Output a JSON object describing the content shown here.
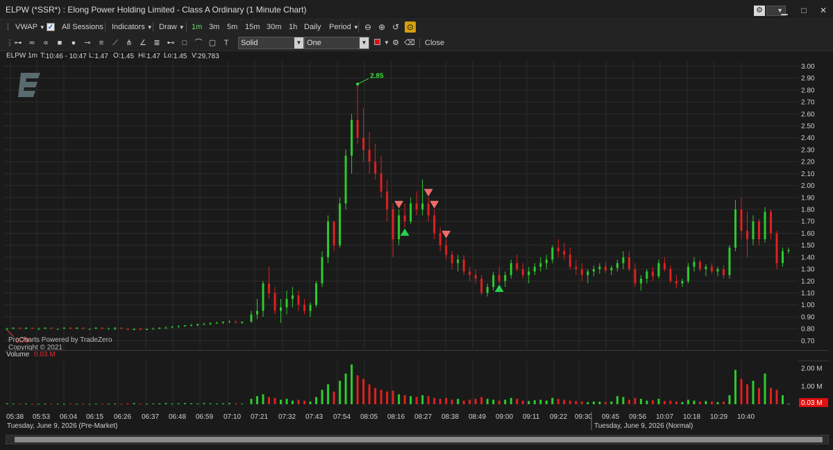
{
  "window": {
    "title": "ELPW (*SSR*) : Elong Power Holding Limited - Class A Ordinary (1 Minute Chart)",
    "minimize": "▁",
    "maximize": "□",
    "close": "✕"
  },
  "toolbar1": {
    "vwap": "VWAP",
    "all_sessions": "All Sessions",
    "indicators": "Indicators",
    "draw": "Draw",
    "intervals": [
      "1m",
      "3m",
      "5m",
      "15m",
      "30m",
      "1h",
      "Daily"
    ],
    "active_interval": "1m",
    "period": "Period"
  },
  "toolbar2": {
    "line_style": "Solid",
    "line_width": "One",
    "close_label": "Close"
  },
  "infobar": {
    "symbol": "ELPW 1m",
    "time": "10:46 - 10:47",
    "last": "1.47",
    "open": "1.45",
    "high": "1.47",
    "low": "1.45",
    "volume": "29,783"
  },
  "volume_panel": {
    "label": "Volume",
    "value": "0.03 M",
    "axis_ticks": [
      "2.00 M",
      "1.00 M"
    ],
    "current_badge": "0.03 M"
  },
  "watermark": {
    "line1": "ProCharts Powered by TradeZero",
    "line2": "Copyright © 2021"
  },
  "x_axis": {
    "ticks": [
      "05:38",
      "05:53",
      "06:04",
      "06:15",
      "06:26",
      "06:37",
      "06:48",
      "06:59",
      "07:10",
      "07:21",
      "07:32",
      "07:43",
      "07:54",
      "08:05",
      "08:16",
      "08:27",
      "08:38",
      "08:49",
      "09:00",
      "09:11",
      "09:22",
      "09:30",
      "09:45",
      "09:56",
      "10:07",
      "10:18",
      "10:29",
      "10:40"
    ],
    "session_premarket": "Tuesday, June 9, 2026 (Pre-Market)",
    "session_normal": "Tuesday, June 9, 2026 (Normal)"
  },
  "chart_data": {
    "type": "candlestick",
    "y_ticks": [
      "3.00",
      "2.90",
      "2.80",
      "2.70",
      "2.60",
      "2.50",
      "2.40",
      "2.30",
      "2.20",
      "2.10",
      "2.00",
      "1.90",
      "1.80",
      "1.70",
      "1.60",
      "1.50",
      "1.40",
      "1.30",
      "1.20",
      "1.10",
      "1.00",
      "0.90",
      "0.80",
      "0.70"
    ],
    "ylim": [
      0.65,
      3.02
    ],
    "high_label": "2.85",
    "low_label": "0.79",
    "colors": {
      "up": "#2ecc2e",
      "down": "#e02020",
      "background": "#1a1a1a",
      "grid": "#2c2c2c"
    },
    "bars": [
      [
        0.8,
        0.81,
        0.79,
        0.8
      ],
      [
        0.8,
        0.81,
        0.8,
        0.81
      ],
      [
        0.81,
        0.81,
        0.8,
        0.8
      ],
      [
        0.8,
        0.81,
        0.8,
        0.81
      ],
      [
        0.81,
        0.81,
        0.8,
        0.8
      ],
      [
        0.8,
        0.81,
        0.79,
        0.8
      ],
      [
        0.8,
        0.81,
        0.8,
        0.81
      ],
      [
        0.81,
        0.81,
        0.8,
        0.8
      ],
      [
        0.8,
        0.8,
        0.79,
        0.8
      ],
      [
        0.8,
        0.81,
        0.8,
        0.81
      ],
      [
        0.81,
        0.81,
        0.8,
        0.8
      ],
      [
        0.8,
        0.81,
        0.8,
        0.81
      ],
      [
        0.81,
        0.81,
        0.8,
        0.8
      ],
      [
        0.8,
        0.8,
        0.79,
        0.8
      ],
      [
        0.8,
        0.81,
        0.8,
        0.81
      ],
      [
        0.81,
        0.81,
        0.8,
        0.8
      ],
      [
        0.8,
        0.81,
        0.8,
        0.8
      ],
      [
        0.8,
        0.81,
        0.79,
        0.81
      ],
      [
        0.81,
        0.81,
        0.8,
        0.8
      ],
      [
        0.8,
        0.8,
        0.79,
        0.79
      ],
      [
        0.79,
        0.8,
        0.79,
        0.8
      ],
      [
        0.8,
        0.81,
        0.79,
        0.79
      ],
      [
        0.79,
        0.8,
        0.79,
        0.8
      ],
      [
        0.8,
        0.81,
        0.8,
        0.8
      ],
      [
        0.8,
        0.81,
        0.8,
        0.81
      ],
      [
        0.81,
        0.82,
        0.8,
        0.81
      ],
      [
        0.81,
        0.82,
        0.81,
        0.82
      ],
      [
        0.82,
        0.83,
        0.81,
        0.82
      ],
      [
        0.82,
        0.83,
        0.82,
        0.83
      ],
      [
        0.83,
        0.84,
        0.82,
        0.83
      ],
      [
        0.83,
        0.84,
        0.82,
        0.84
      ],
      [
        0.84,
        0.85,
        0.83,
        0.84
      ],
      [
        0.84,
        0.85,
        0.83,
        0.85
      ],
      [
        0.85,
        0.86,
        0.84,
        0.85
      ],
      [
        0.85,
        0.86,
        0.84,
        0.86
      ],
      [
        0.86,
        0.87,
        0.85,
        0.86
      ],
      [
        0.86,
        0.87,
        0.85,
        0.85
      ],
      [
        0.85,
        0.86,
        0.84,
        0.86
      ],
      [
        0.86,
        0.95,
        0.85,
        0.92
      ],
      [
        0.92,
        1.05,
        0.88,
        0.95
      ],
      [
        0.95,
        1.2,
        0.9,
        1.18
      ],
      [
        1.18,
        1.32,
        1.05,
        1.1
      ],
      [
        1.1,
        1.15,
        0.92,
        0.95
      ],
      [
        0.95,
        1.05,
        0.85,
        0.98
      ],
      [
        0.98,
        1.12,
        0.92,
        1.05
      ],
      [
        1.05,
        1.15,
        0.98,
        1.08
      ],
      [
        1.08,
        1.12,
        0.95,
        1.0
      ],
      [
        1.0,
        1.05,
        0.92,
        0.95
      ],
      [
        0.95,
        1.02,
        0.9,
        1.0
      ],
      [
        1.0,
        1.2,
        0.98,
        1.18
      ],
      [
        1.18,
        1.45,
        1.15,
        1.4
      ],
      [
        1.4,
        1.75,
        1.35,
        1.7
      ],
      [
        1.7,
        1.6,
        1.45,
        1.5
      ],
      [
        1.5,
        1.9,
        1.48,
        1.85
      ],
      [
        1.85,
        2.3,
        1.8,
        2.25
      ],
      [
        2.25,
        2.6,
        2.1,
        2.55
      ],
      [
        2.55,
        2.85,
        2.35,
        2.4
      ],
      [
        2.4,
        2.65,
        2.2,
        2.3
      ],
      [
        2.3,
        2.45,
        2.1,
        2.2
      ],
      [
        2.2,
        2.35,
        2.05,
        2.1
      ],
      [
        2.1,
        2.25,
        1.9,
        1.95
      ],
      [
        1.95,
        2.05,
        1.7,
        1.8
      ],
      [
        1.8,
        1.85,
        1.4,
        1.55
      ],
      [
        1.55,
        1.8,
        1.5,
        1.75
      ],
      [
        1.75,
        1.85,
        1.65,
        1.7
      ],
      [
        1.7,
        1.9,
        1.68,
        1.85
      ],
      [
        1.85,
        1.95,
        1.75,
        1.8
      ],
      [
        1.8,
        2.05,
        1.75,
        1.85
      ],
      [
        1.85,
        1.9,
        1.7,
        1.75
      ],
      [
        1.75,
        1.8,
        1.55,
        1.6
      ],
      [
        1.6,
        1.65,
        1.45,
        1.5
      ],
      [
        1.5,
        1.55,
        1.38,
        1.42
      ],
      [
        1.42,
        1.45,
        1.3,
        1.35
      ],
      [
        1.35,
        1.42,
        1.28,
        1.38
      ],
      [
        1.38,
        1.42,
        1.25,
        1.28
      ],
      [
        1.28,
        1.32,
        1.2,
        1.25
      ],
      [
        1.25,
        1.3,
        1.18,
        1.22
      ],
      [
        1.22,
        1.25,
        1.08,
        1.1
      ],
      [
        1.1,
        1.18,
        1.07,
        1.15
      ],
      [
        1.15,
        1.28,
        1.12,
        1.25
      ],
      [
        1.25,
        1.32,
        1.18,
        1.2
      ],
      [
        1.2,
        1.28,
        1.15,
        1.25
      ],
      [
        1.25,
        1.38,
        1.22,
        1.35
      ],
      [
        1.35,
        1.42,
        1.28,
        1.3
      ],
      [
        1.3,
        1.35,
        1.22,
        1.25
      ],
      [
        1.25,
        1.32,
        1.18,
        1.28
      ],
      [
        1.28,
        1.35,
        1.25,
        1.32
      ],
      [
        1.32,
        1.4,
        1.28,
        1.35
      ],
      [
        1.35,
        1.42,
        1.3,
        1.38
      ],
      [
        1.38,
        1.5,
        1.35,
        1.48
      ],
      [
        1.48,
        1.55,
        1.4,
        1.45
      ],
      [
        1.45,
        1.52,
        1.38,
        1.42
      ],
      [
        1.42,
        1.48,
        1.3,
        1.32
      ],
      [
        1.32,
        1.38,
        1.25,
        1.3
      ],
      [
        1.3,
        1.35,
        1.2,
        1.25
      ],
      [
        1.25,
        1.3,
        1.18,
        1.28
      ],
      [
        1.28,
        1.33,
        1.24,
        1.3
      ],
      [
        1.3,
        1.35,
        1.26,
        1.32
      ],
      [
        1.32,
        1.36,
        1.27,
        1.29
      ],
      [
        1.29,
        1.33,
        1.25,
        1.31
      ],
      [
        1.31,
        1.38,
        1.28,
        1.35
      ],
      [
        1.35,
        1.45,
        1.3,
        1.4
      ],
      [
        1.4,
        1.45,
        1.28,
        1.3
      ],
      [
        1.3,
        1.35,
        1.15,
        1.18
      ],
      [
        1.18,
        1.25,
        1.12,
        1.22
      ],
      [
        1.22,
        1.3,
        1.18,
        1.28
      ],
      [
        1.28,
        1.32,
        1.2,
        1.24
      ],
      [
        1.24,
        1.38,
        1.22,
        1.35
      ],
      [
        1.35,
        1.4,
        1.28,
        1.3
      ],
      [
        1.3,
        1.33,
        1.18,
        1.2
      ],
      [
        1.2,
        1.25,
        1.14,
        1.18
      ],
      [
        1.18,
        1.22,
        1.15,
        1.2
      ],
      [
        1.2,
        1.35,
        1.18,
        1.32
      ],
      [
        1.32,
        1.4,
        1.28,
        1.36
      ],
      [
        1.36,
        1.38,
        1.28,
        1.3
      ],
      [
        1.3,
        1.34,
        1.24,
        1.32
      ],
      [
        1.32,
        1.35,
        1.26,
        1.28
      ],
      [
        1.28,
        1.32,
        1.24,
        1.3
      ],
      [
        1.3,
        1.33,
        1.22,
        1.25
      ],
      [
        1.25,
        1.5,
        1.22,
        1.48
      ],
      [
        1.48,
        1.88,
        1.45,
        1.8
      ],
      [
        1.8,
        1.9,
        1.55,
        1.62
      ],
      [
        1.62,
        1.78,
        1.4,
        1.55
      ],
      [
        1.55,
        1.75,
        1.5,
        1.7
      ],
      [
        1.7,
        1.72,
        1.5,
        1.55
      ],
      [
        1.55,
        1.82,
        1.52,
        1.78
      ],
      [
        1.78,
        1.8,
        1.55,
        1.6
      ],
      [
        1.6,
        1.62,
        1.3,
        1.35
      ],
      [
        1.35,
        1.48,
        1.32,
        1.45
      ],
      [
        1.45,
        1.48,
        1.43,
        1.46
      ]
    ],
    "volume": [
      0.05,
      0.04,
      0.03,
      0.04,
      0.02,
      0.03,
      0.03,
      0.02,
      0.03,
      0.02,
      0.04,
      0.02,
      0.03,
      0.02,
      0.03,
      0.02,
      0.03,
      0.04,
      0.02,
      0.05,
      0.06,
      0.04,
      0.03,
      0.04,
      0.05,
      0.06,
      0.04,
      0.05,
      0.06,
      0.05,
      0.04,
      0.06,
      0.05,
      0.04,
      0.05,
      0.06,
      0.05,
      0.04,
      0.3,
      0.45,
      0.55,
      0.4,
      0.35,
      0.25,
      0.3,
      0.2,
      0.25,
      0.2,
      0.15,
      0.4,
      0.8,
      1.1,
      0.7,
      1.3,
      1.7,
      2.2,
      1.6,
      1.4,
      1.1,
      0.9,
      0.8,
      0.7,
      0.75,
      0.55,
      0.5,
      0.45,
      0.4,
      0.5,
      0.45,
      0.35,
      0.3,
      0.35,
      0.25,
      0.3,
      0.2,
      0.25,
      0.3,
      0.4,
      0.3,
      0.25,
      0.2,
      0.25,
      0.35,
      0.3,
      0.2,
      0.18,
      0.22,
      0.25,
      0.2,
      0.35,
      0.3,
      0.25,
      0.2,
      0.18,
      0.15,
      0.12,
      0.15,
      0.14,
      0.12,
      0.15,
      0.45,
      0.4,
      0.25,
      0.35,
      0.3,
      0.2,
      0.22,
      0.3,
      0.18,
      0.2,
      0.15,
      0.12,
      0.25,
      0.2,
      0.15,
      0.18,
      0.15,
      0.12,
      0.14,
      0.5,
      1.9,
      1.4,
      1.1,
      1.3,
      0.9,
      1.7,
      0.9,
      0.8,
      0.5,
      0.03
    ],
    "buy_markers": [
      64,
      80
    ],
    "sell_markers": [
      63,
      68,
      69,
      71
    ]
  }
}
